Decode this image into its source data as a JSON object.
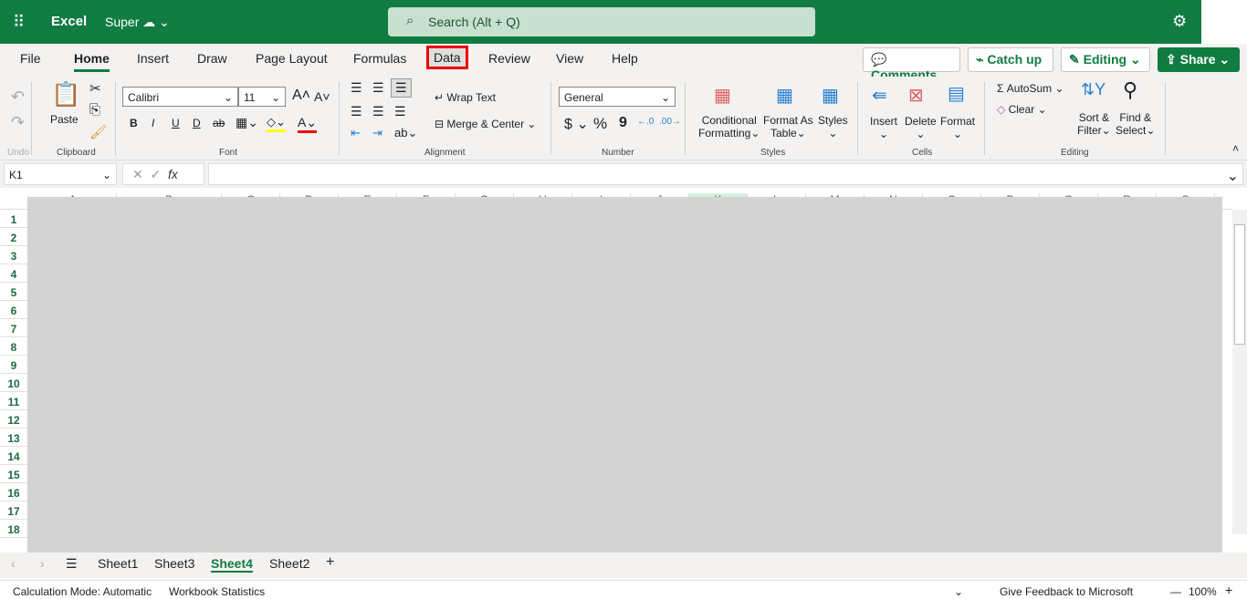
{
  "header": {
    "app": "Excel",
    "doc": "Super",
    "search_placeholder": "Search (Alt + Q)"
  },
  "menu": [
    "File",
    "Home",
    "Insert",
    "Draw",
    "Page Layout",
    "Formulas",
    "Data",
    "Review",
    "View",
    "Help"
  ],
  "actions": {
    "comments": "Comments",
    "catchup": "Catch up",
    "editing": "Editing",
    "share": "Share"
  },
  "ribbon": {
    "undo": "Undo",
    "paste": "Paste",
    "clipboard": "Clipboard",
    "font_name": "Calibri",
    "font_size": "11",
    "font": "Font",
    "wrap": "Wrap Text",
    "merge": "Merge & Center",
    "alignment": "Alignment",
    "number_format": "General",
    "number": "Number",
    "cond1": "Conditional",
    "cond2": "Formatting",
    "fat1": "Format As",
    "fat2": "Table",
    "styles_btn": "Styles",
    "styles": "Styles",
    "insert": "Insert",
    "delete": "Delete",
    "format": "Format",
    "cells": "Cells",
    "autosum": "AutoSum",
    "clear": "Clear",
    "sort1": "Sort &",
    "sort2": "Filter",
    "find1": "Find &",
    "find2": "Select",
    "editing": "Editing",
    "bold": "B",
    "italic": "I",
    "underline": "U",
    "dunder": "D",
    "strike": "ab",
    "fontcolor": "A",
    "dollar": "$",
    "percent": "%",
    "comma": "9"
  },
  "formula": {
    "namebox": "K1",
    "value": ""
  },
  "columns": [
    "A",
    "B",
    "C",
    "D",
    "E",
    "F",
    "G",
    "H",
    "I",
    "J",
    "K",
    "L",
    "M",
    "N",
    "O",
    "P",
    "Q",
    "R",
    "S"
  ],
  "rows": [
    "1",
    "2",
    "3",
    "4",
    "5",
    "6",
    "7",
    "8",
    "9",
    "10",
    "11",
    "12",
    "13",
    "14",
    "15",
    "16",
    "17",
    "18"
  ],
  "sheets": [
    "Sheet1",
    "Sheet3",
    "Sheet4",
    "Sheet2"
  ],
  "active_sheet": "Sheet4",
  "status": {
    "calc": "Calculation Mode: Automatic",
    "stats": "Workbook Statistics",
    "feedback": "Give Feedback to Microsoft",
    "zoom": "100%"
  },
  "colors": {
    "brand": "#107c41",
    "highlight": "#e00000"
  }
}
